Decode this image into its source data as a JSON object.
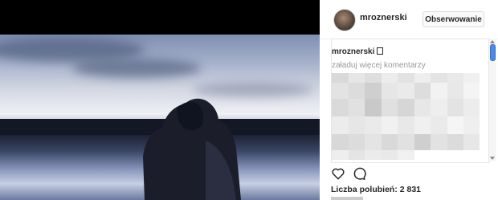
{
  "post": {
    "username": "mroznerski",
    "follow_label": "Obserwowanie",
    "caption_user": "mroznerski",
    "load_more": "załaduj więcej komentarzy",
    "likes": "Liczba polubień: 2 831"
  },
  "icons": {
    "like": "heart-icon",
    "comment": "comment-icon"
  },
  "colors": {
    "scroll_thumb": "#4a8ae8",
    "text": "#262626",
    "muted": "#999999"
  }
}
